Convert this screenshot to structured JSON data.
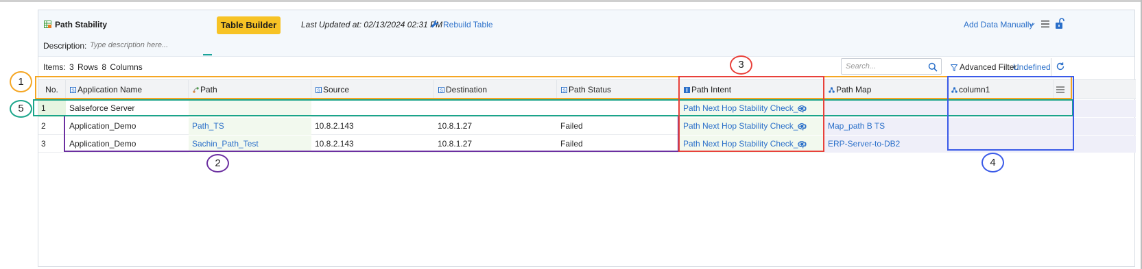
{
  "header": {
    "title": "Path Stability",
    "table_builder_label": "Table Builder",
    "last_updated": "Last Updated at: 02/13/2024 02:31 PM",
    "rebuild_label": "Rebuild Table",
    "add_data_label": "Add Data Manually",
    "description_label": "Description:",
    "description_placeholder": "Type description here..."
  },
  "toolbar": {
    "items_label": "Items:",
    "rows_text": "3 Rows",
    "columns_text": "8 Columns",
    "search_placeholder": "Search...",
    "advanced_filter_label": "Advanced Filter:",
    "advanced_filter_value": "Undefined"
  },
  "table": {
    "columns": [
      {
        "label": "No.",
        "icon": "none"
      },
      {
        "label": "Application Name",
        "icon": "string-icon"
      },
      {
        "label": "Path",
        "icon": "path-icon"
      },
      {
        "label": "Source",
        "icon": "string-icon"
      },
      {
        "label": "Destination",
        "icon": "string-icon"
      },
      {
        "label": "Path Status",
        "icon": "string-icon"
      },
      {
        "label": "Path Intent",
        "icon": "intent-icon"
      },
      {
        "label": "Path Map",
        "icon": "map-icon"
      },
      {
        "label": "column1",
        "icon": "map-icon"
      }
    ],
    "rows": [
      {
        "no": "1",
        "app": "Salseforce Server",
        "path": "",
        "source": "",
        "destination": "",
        "status": "",
        "intent": "Path Next Hop Stability Check_sp",
        "map": "",
        "column1": ""
      },
      {
        "no": "2",
        "app": "Application_Demo",
        "path": "Path_TS",
        "source": "10.8.2.143",
        "destination": "10.8.1.27",
        "status": "Failed",
        "intent": "Path Next Hop Stability Check_sp",
        "map": "Map_path B TS",
        "column1": ""
      },
      {
        "no": "3",
        "app": "Application_Demo",
        "path": "Sachin_Path_Test",
        "source": "10.8.2.143",
        "destination": "10.8.1.27",
        "status": "Failed",
        "intent": "Path Next Hop Stability Check_sp",
        "map": "ERP-Server-to-DB2",
        "column1": ""
      }
    ]
  },
  "annotations": {
    "a1": "1",
    "a2": "2",
    "a3": "3",
    "a4": "4",
    "a5": "5"
  },
  "colors": {
    "accent_button": "#f7c325",
    "link": "#2a6fc9",
    "ann_orange": "#f5a623",
    "ann_purple": "#6b2fa0",
    "ann_red": "#e8403a",
    "ann_blue": "#3a5ae8",
    "ann_teal": "#1aa58a"
  }
}
